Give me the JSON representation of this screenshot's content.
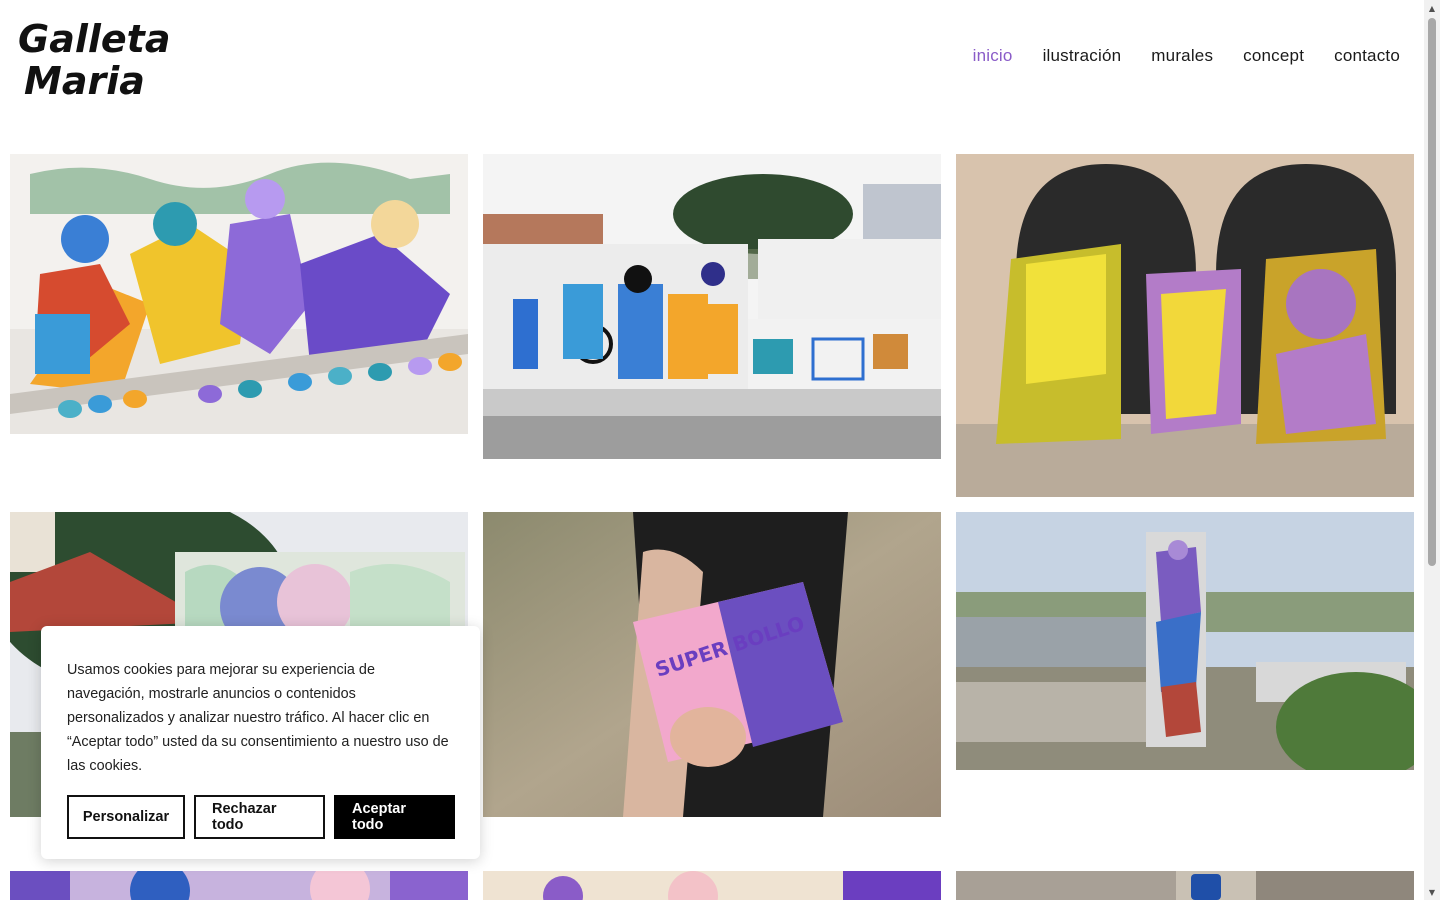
{
  "logo": {
    "line1": "Galleta",
    "line2": "Maria"
  },
  "nav": {
    "items": [
      {
        "label": "inicio",
        "active": true
      },
      {
        "label": "ilustración",
        "active": false
      },
      {
        "label": "murales",
        "active": false
      },
      {
        "label": "concept",
        "active": false
      },
      {
        "label": "contacto",
        "active": false
      }
    ]
  },
  "gallery": {
    "items": [
      {
        "name": "gallery-mural-beekeepers"
      },
      {
        "name": "gallery-mural-street-wall"
      },
      {
        "name": "gallery-painted-panels"
      },
      {
        "name": "gallery-mural-house"
      },
      {
        "name": "gallery-book-superbollo"
      },
      {
        "name": "gallery-silo-mural"
      },
      {
        "name": "gallery-mural-faces"
      },
      {
        "name": "gallery-mural-pink"
      },
      {
        "name": "gallery-storefront"
      }
    ]
  },
  "cookie_banner": {
    "text": "Usamos cookies para mejorar su experiencia de navegación, mostrarle anuncios o contenidos personalizados y analizar nuestro tráfico. Al hacer clic en “Aceptar todo” usted da su consentimiento a nuestro uso de las cookies.",
    "customize_label": "Personalizar",
    "reject_label": "Rechazar todo",
    "accept_label": "Aceptar todo"
  },
  "book_cover": {
    "title": "SUPER BOLLO"
  },
  "colors": {
    "accent": "#8a5cc8",
    "text": "#1a1a1a",
    "button_dark": "#000000"
  }
}
